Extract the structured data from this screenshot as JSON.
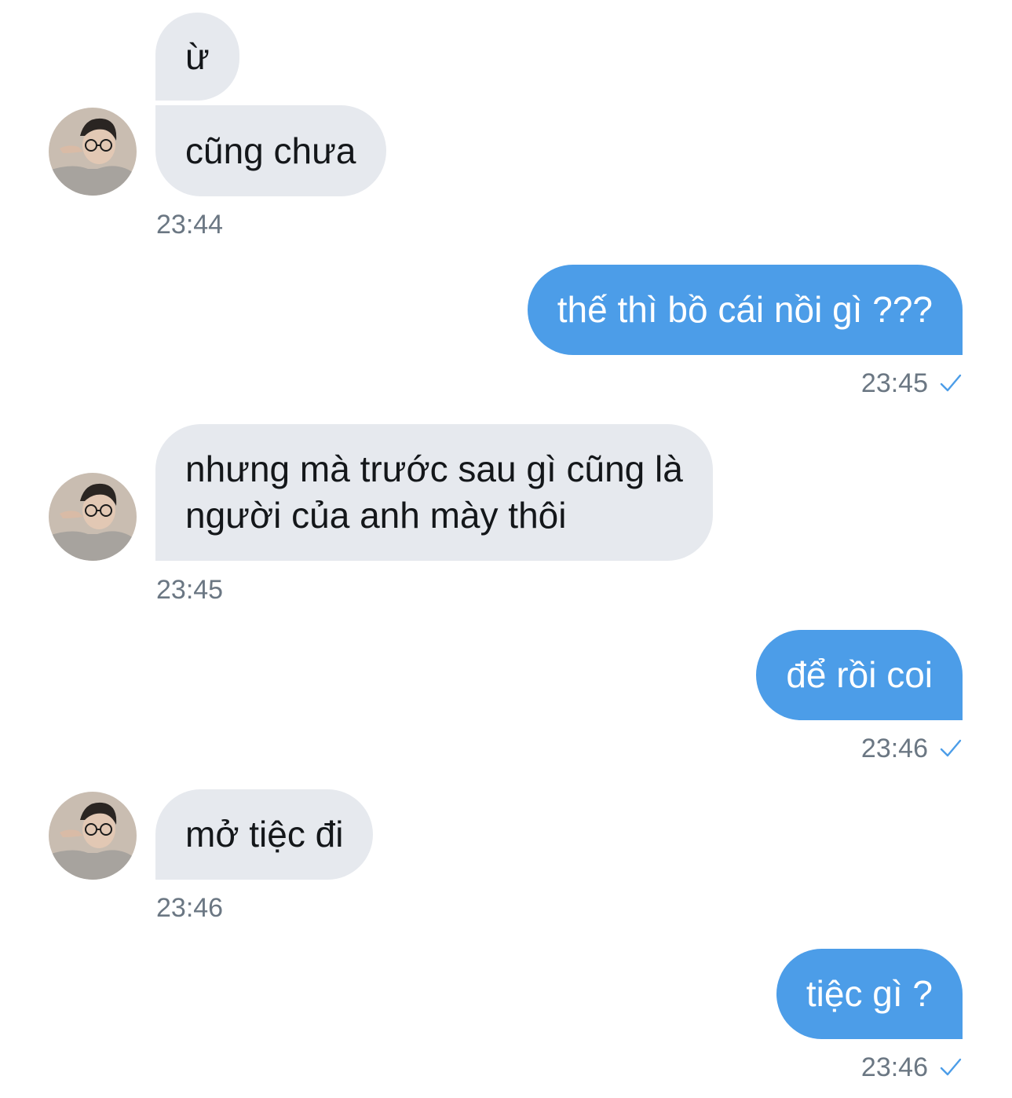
{
  "conversation": {
    "messages": [
      {
        "direction": "incoming",
        "text": "ừ"
      },
      {
        "direction": "incoming",
        "text": "cũng chưa",
        "time": "23:44"
      },
      {
        "direction": "outgoing",
        "text": "thế thì bồ cái nồi gì ???",
        "time": "23:45"
      },
      {
        "direction": "incoming",
        "lines": [
          "nhưng mà trước sau gì cũng là",
          "người của anh mày thôi"
        ],
        "time": "23:45"
      },
      {
        "direction": "outgoing",
        "text": "để rồi coi",
        "time": "23:46"
      },
      {
        "direction": "incoming",
        "text": "mở tiệc đi",
        "time": "23:46"
      },
      {
        "direction": "outgoing",
        "text": "tiệc gì ?",
        "time": "23:46"
      }
    ]
  },
  "icons": {
    "read_receipt": "checkmark-icon",
    "avatar": "avatar-photo"
  },
  "colors": {
    "incoming_bubble": "#e6e9ee",
    "outgoing_bubble": "#4c9de8",
    "timestamp": "#6b7783",
    "check": "#4c9de8"
  }
}
